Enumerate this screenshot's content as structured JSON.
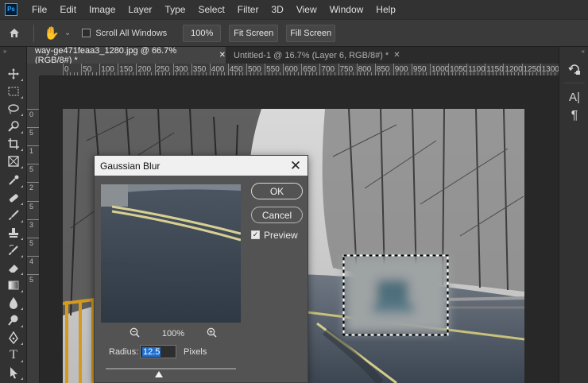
{
  "app": {
    "logo_text": "Ps"
  },
  "menu": [
    "File",
    "Edit",
    "Image",
    "Layer",
    "Type",
    "Select",
    "Filter",
    "3D",
    "View",
    "Window",
    "Help"
  ],
  "options_bar": {
    "scroll_all_windows": "Scroll All Windows",
    "zoom_100": "100%",
    "fit_screen": "Fit Screen",
    "fill_screen": "Fill Screen"
  },
  "tabs": [
    {
      "label": "way-ge471feaa3_1280.jpg @ 66.7% (RGB/8#) *",
      "active": true
    },
    {
      "label": "Untitled-1 @ 16.7% (Layer 6, RGB/8#) *",
      "active": false
    }
  ],
  "ruler_top": [
    "0",
    "50",
    "100",
    "150",
    "200",
    "250",
    "300",
    "350",
    "400",
    "450",
    "500",
    "550",
    "600",
    "650",
    "700",
    "750",
    "800",
    "850",
    "900",
    "950",
    "1000",
    "1050",
    "1100",
    "1150",
    "1200",
    "1250",
    "1300"
  ],
  "ruler_left": [
    "0",
    "5",
    "1",
    "5",
    "2",
    "5",
    "3",
    "5",
    "4",
    "5"
  ],
  "dialog": {
    "title": "Gaussian Blur",
    "ok": "OK",
    "cancel": "Cancel",
    "preview": "Preview",
    "preview_checked": true,
    "zoom": "100%",
    "radius_label": "Radius:",
    "radius_value": "12.5",
    "radius_unit": "Pixels",
    "slider_fraction": 0.41
  },
  "icons": {
    "toolbar": [
      "move-icon",
      "marquee-icon",
      "lasso-icon",
      "quick-select-icon",
      "crop-icon",
      "frame-icon",
      "eyedropper-icon",
      "healing-icon",
      "brush-icon",
      "stamp-icon",
      "history-brush-icon",
      "eraser-icon",
      "gradient-icon",
      "blur-icon",
      "dodge-icon",
      "pen-icon",
      "type-icon",
      "path-select-icon"
    ],
    "right_panel": [
      "history-panel-icon",
      "character-panel-icon",
      "paragraph-panel-icon"
    ]
  }
}
